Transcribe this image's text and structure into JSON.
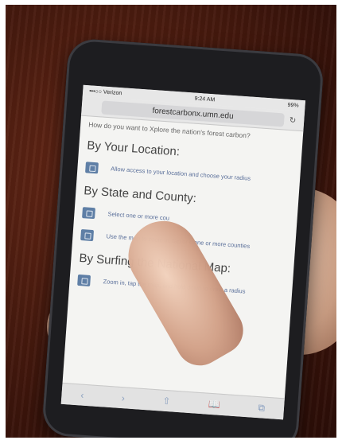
{
  "status": {
    "carrier": "•••○○ Verizon",
    "time": "9:24 AM",
    "battery": "99%"
  },
  "url": "forestcarbonx.umn.edu",
  "intro": "How do you want to Xplore the nation's forest carbon?",
  "sections": [
    {
      "heading": "By Your Location:",
      "options": [
        "Allow access to your location and choose your radius"
      ]
    },
    {
      "heading": "By State and County:",
      "options": [
        "Select one or more cou",
        "Use the map to zoom in, tap or c one or more counties"
      ]
    },
    {
      "heading": "By Surfing the National Map:",
      "options": [
        "Zoom in, tap the map, and hold down to draw a radius"
      ]
    }
  ],
  "toolbar": {
    "back": "‹",
    "forward": "›",
    "share": "⇧",
    "bookmarks": "📖",
    "tabs": "⧉"
  }
}
